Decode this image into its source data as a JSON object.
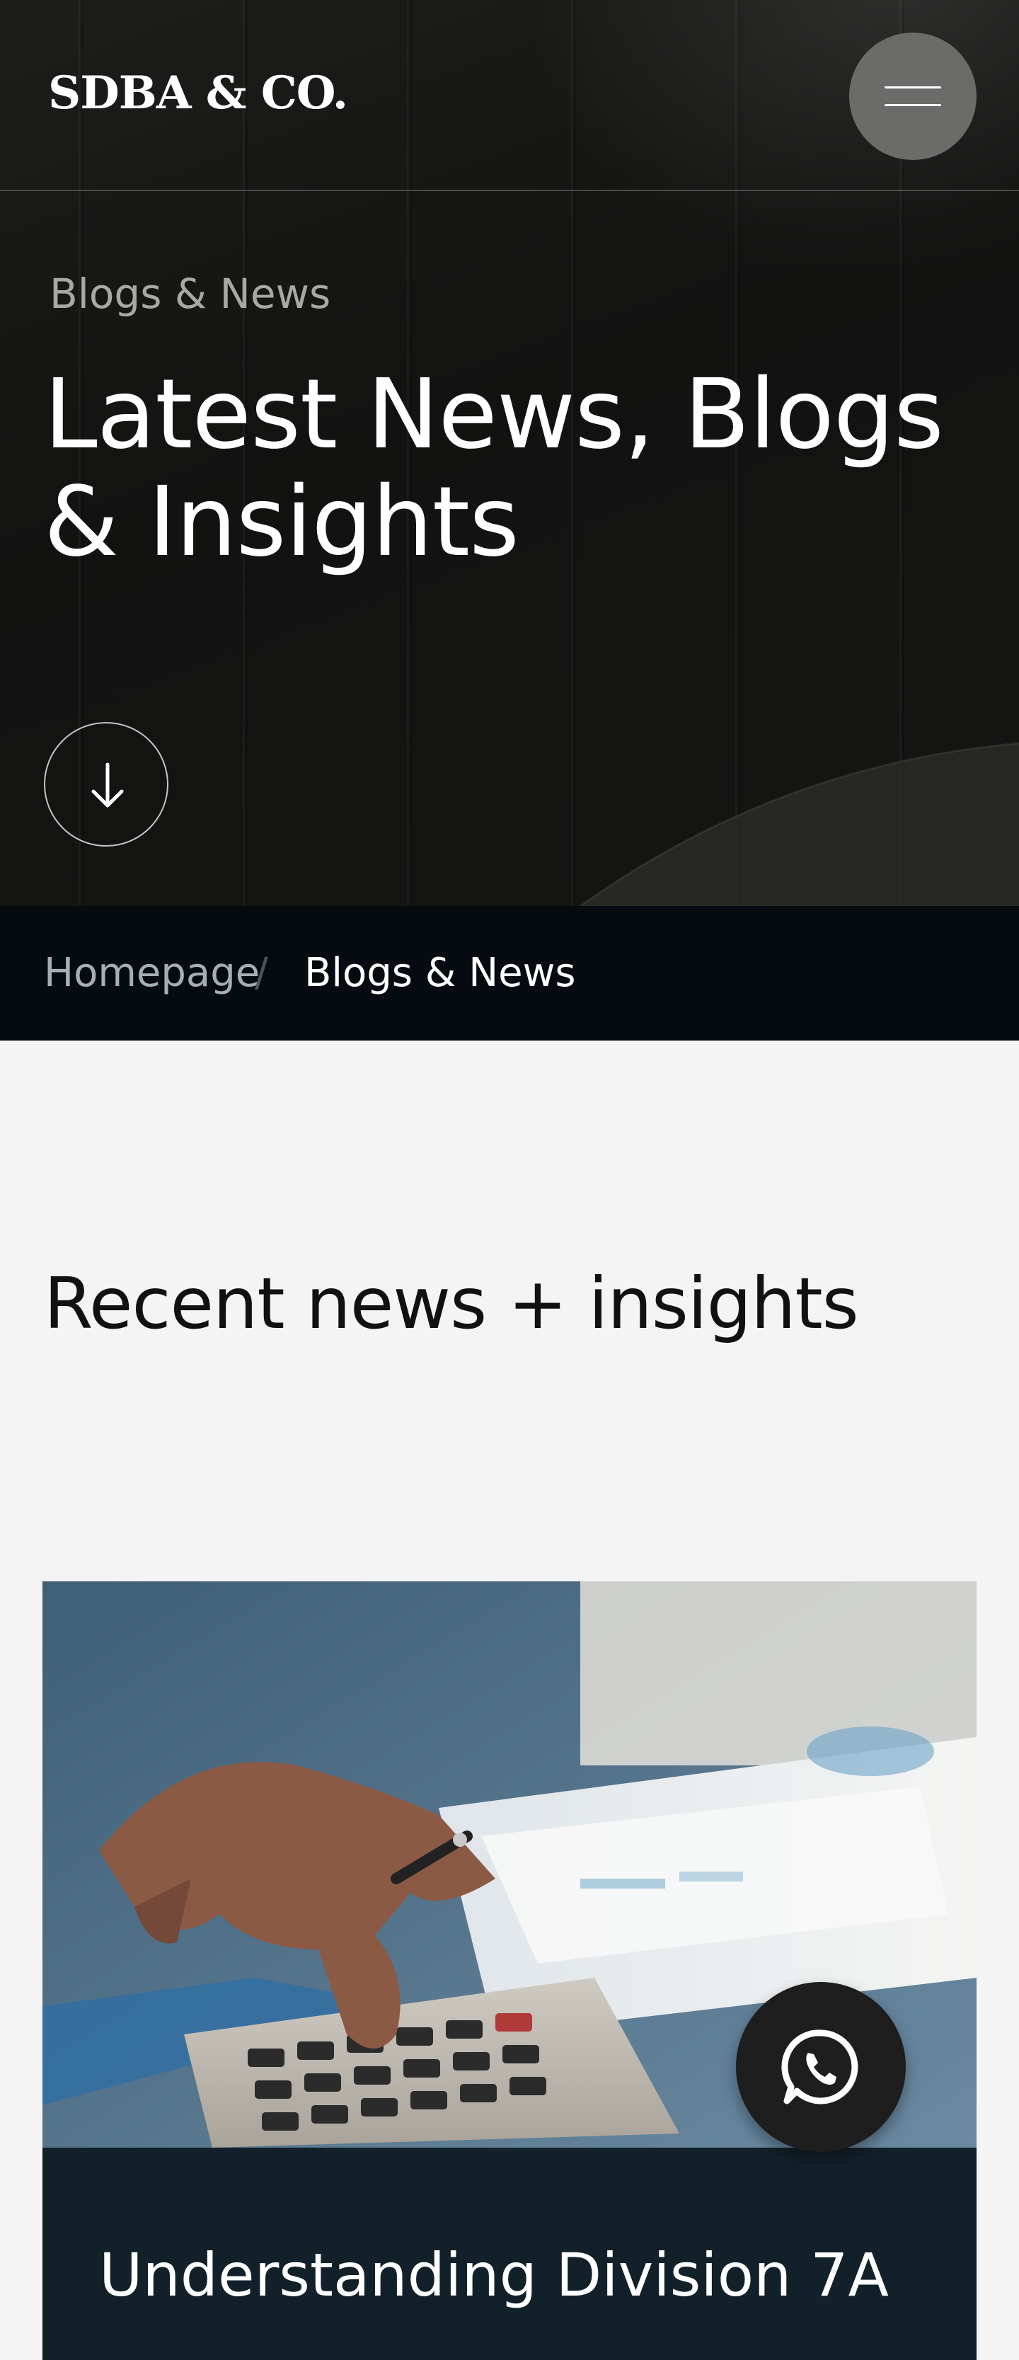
{
  "header": {
    "logo": "SDBA & CO.",
    "menu_icon": "hamburger-icon"
  },
  "hero": {
    "eyebrow": "Blogs & News",
    "title": "Latest News, Blogs & Insights",
    "scroll_icon": "arrow-down-icon"
  },
  "breadcrumb": {
    "home": "Homepage",
    "separator": "/",
    "current": "Blogs & News"
  },
  "recent": {
    "title": "Recent news + insights",
    "cards": [
      {
        "title": "Understanding Division 7A",
        "image": "calculator-finance-photo"
      }
    ]
  },
  "whatsapp": {
    "icon": "whatsapp-icon"
  },
  "colors": {
    "hero_bg": "#151514",
    "breadcrumb_bg": "#050b10",
    "page_bg": "#f4f4f4",
    "card_body_bg": "#12202a",
    "menu_button_bg": "#6b6b6a",
    "whatsapp_bg": "#1e1e1e"
  }
}
